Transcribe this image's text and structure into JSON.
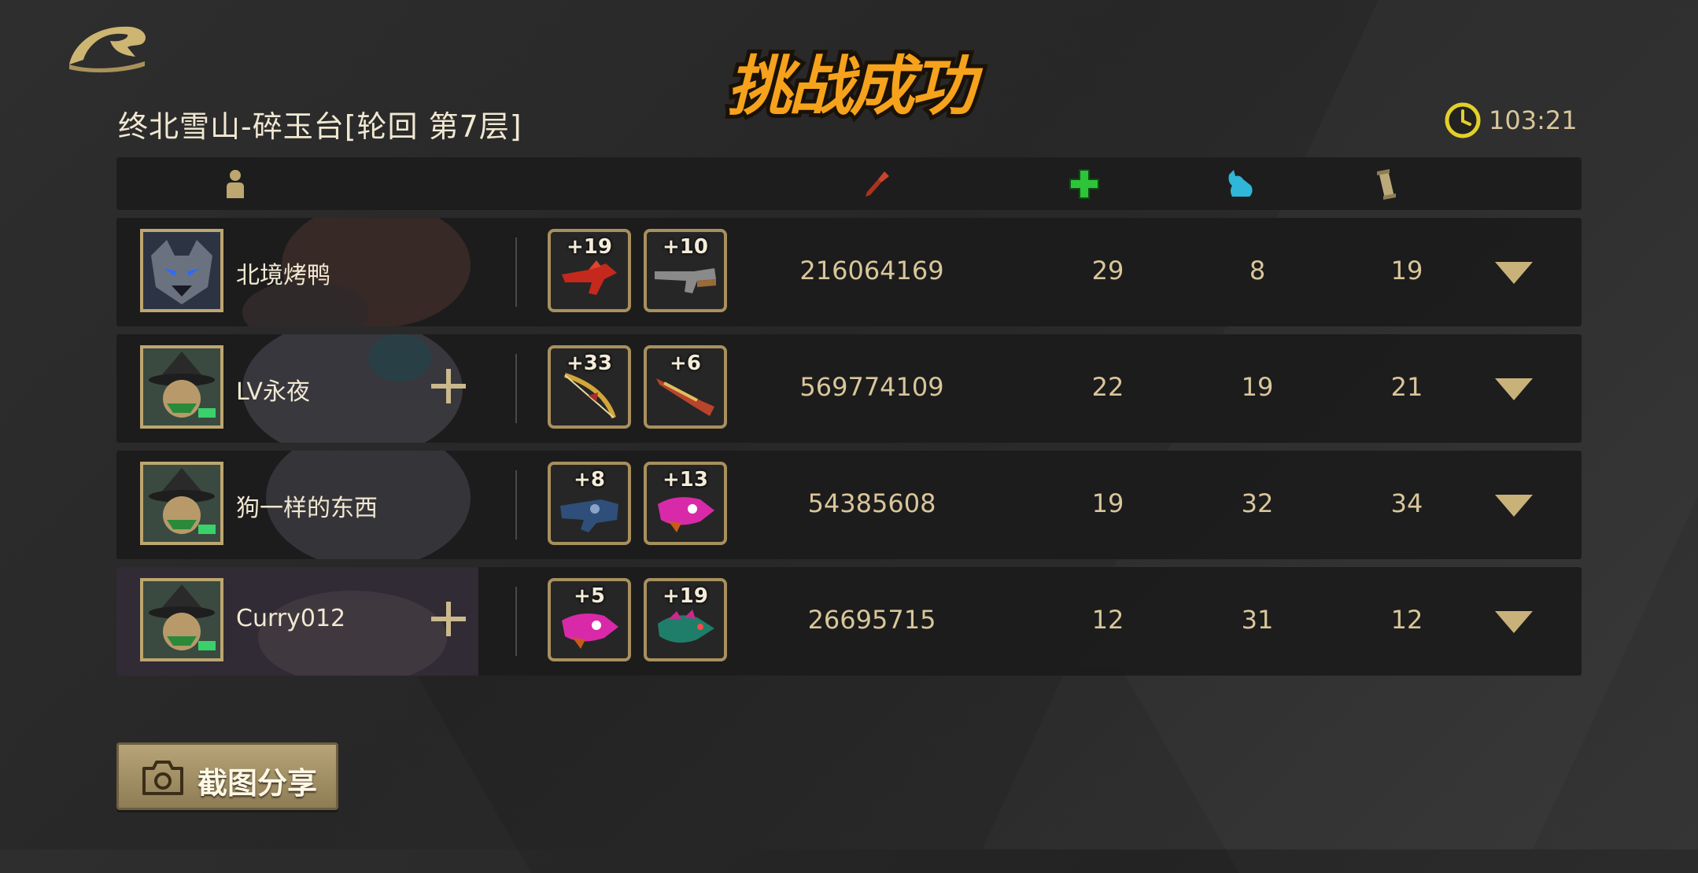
{
  "stage": {
    "title": "终北雪山-碎玉台[轮回  第7层]",
    "result_banner": "挑战成功"
  },
  "timer": {
    "value": "103:21",
    "icon": "clock-icon"
  },
  "header": {
    "columns": [
      {
        "icon": "player-icon",
        "color": "#bda670"
      },
      {
        "icon": "damage-icon",
        "color": "#c8452c"
      },
      {
        "icon": "heal-cross-icon",
        "color": "#2ec43a"
      },
      {
        "icon": "pet-icon",
        "color": "#2fb6d8"
      },
      {
        "icon": "scroll-icon",
        "color": "#bca97a"
      }
    ]
  },
  "players": [
    {
      "name": "北境烤鸭",
      "has_add_button": false,
      "weapons": [
        {
          "level": "+19",
          "color": "#c5281c"
        },
        {
          "level": "+10",
          "color": "#8a8a8a"
        }
      ],
      "damage": "216064169",
      "heal": "29",
      "pet": "8",
      "scroll": "19"
    },
    {
      "name": "LV永夜",
      "has_add_button": true,
      "weapons": [
        {
          "level": "+33",
          "color": "#d4a63a"
        },
        {
          "level": "+6",
          "color": "#b8442a"
        }
      ],
      "damage": "569774109",
      "heal": "22",
      "pet": "19",
      "scroll": "21"
    },
    {
      "name": "狗一样的东西",
      "has_add_button": false,
      "weapons": [
        {
          "level": "+8",
          "color": "#2f4f7a"
        },
        {
          "level": "+13",
          "color": "#d82aa8"
        }
      ],
      "damage": "54385608",
      "heal": "19",
      "pet": "32",
      "scroll": "34"
    },
    {
      "name": "Curry012",
      "has_add_button": true,
      "weapons": [
        {
          "level": "+5",
          "color": "#d82aa8"
        },
        {
          "level": "+19",
          "color": "#1e7e6a"
        }
      ],
      "damage": "26695715",
      "heal": "12",
      "pet": "31",
      "scroll": "12"
    }
  ],
  "share": {
    "label": "截图分享",
    "icon": "camera-icon"
  },
  "colors": {
    "accent_gold": "#bda670",
    "banner_orange": "#f7a21c"
  }
}
